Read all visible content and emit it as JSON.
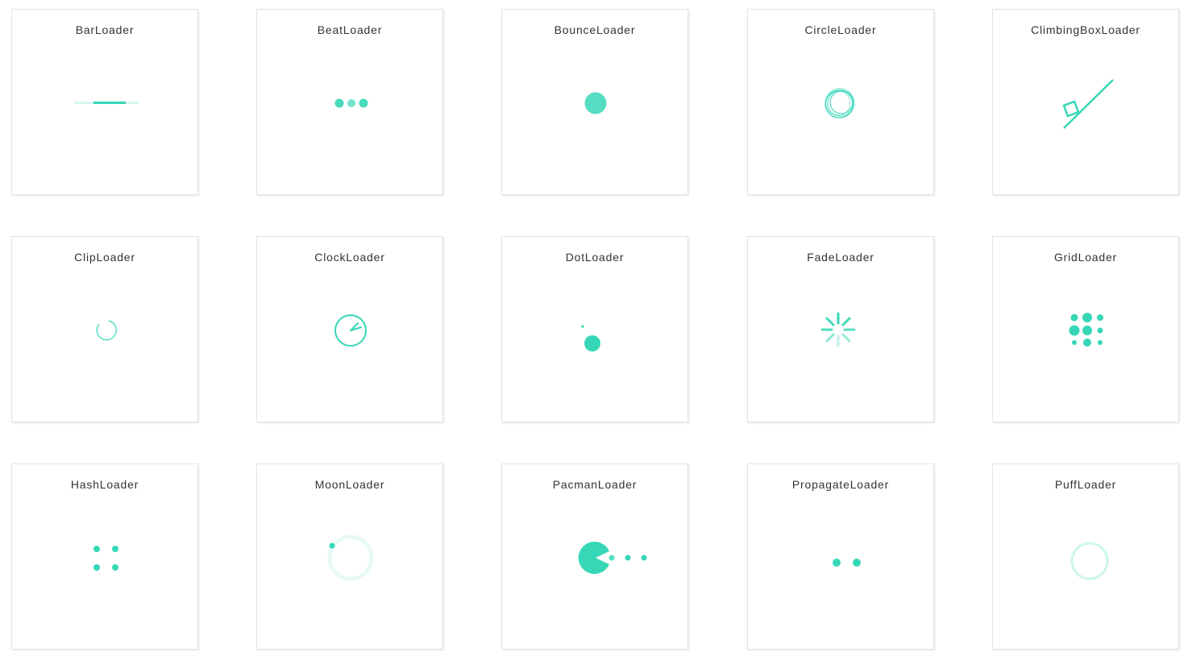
{
  "theme": {
    "accent": "#36d7b7"
  },
  "loaders": [
    {
      "name": "BarLoader",
      "icon": "bar-loader-icon"
    },
    {
      "name": "BeatLoader",
      "icon": "beat-loader-icon"
    },
    {
      "name": "BounceLoader",
      "icon": "bounce-loader-icon"
    },
    {
      "name": "CircleLoader",
      "icon": "circle-loader-icon"
    },
    {
      "name": "ClimbingBoxLoader",
      "icon": "climbing-box-loader-icon"
    },
    {
      "name": "ClipLoader",
      "icon": "clip-loader-icon"
    },
    {
      "name": "ClockLoader",
      "icon": "clock-loader-icon"
    },
    {
      "name": "DotLoader",
      "icon": "dot-loader-icon"
    },
    {
      "name": "FadeLoader",
      "icon": "fade-loader-icon"
    },
    {
      "name": "GridLoader",
      "icon": "grid-loader-icon"
    },
    {
      "name": "HashLoader",
      "icon": "hash-loader-icon"
    },
    {
      "name": "MoonLoader",
      "icon": "moon-loader-icon"
    },
    {
      "name": "PacmanLoader",
      "icon": "pacman-loader-icon"
    },
    {
      "name": "PropagateLoader",
      "icon": "propagate-loader-icon"
    },
    {
      "name": "PuffLoader",
      "icon": "puff-loader-icon"
    }
  ]
}
